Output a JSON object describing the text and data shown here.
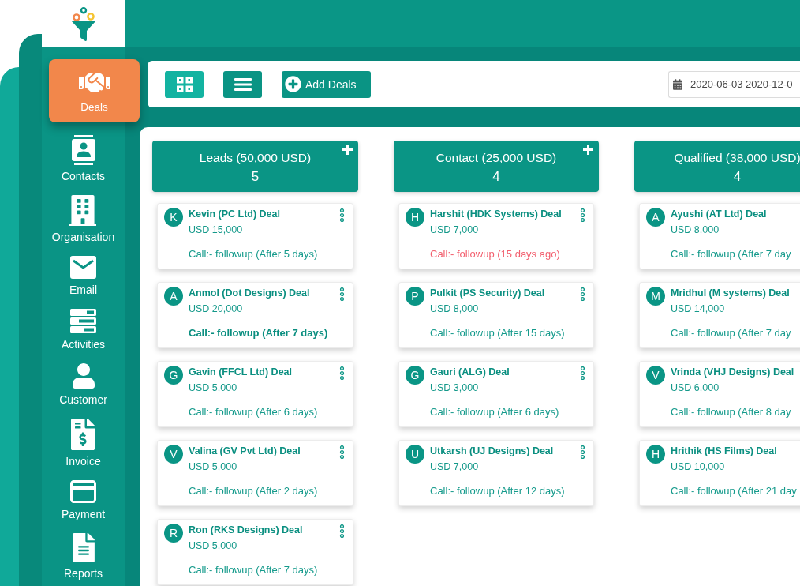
{
  "sidebar": {
    "items": [
      {
        "label": "Deals",
        "selected": true
      },
      {
        "label": "Contacts",
        "selected": false
      },
      {
        "label": "Organisation",
        "selected": false
      },
      {
        "label": "Email",
        "selected": false
      },
      {
        "label": "Activities",
        "selected": false
      },
      {
        "label": "Customer",
        "selected": false
      },
      {
        "label": "Invoice",
        "selected": false
      },
      {
        "label": "Payment",
        "selected": false
      },
      {
        "label": "Reports",
        "selected": false
      }
    ]
  },
  "toolbar": {
    "view_buttons": [
      {
        "kind": "grid",
        "selected": true
      },
      {
        "kind": "list",
        "selected": false
      }
    ],
    "add_button": {
      "label": "Add Deals"
    },
    "date_range": {
      "value": "2020-06-03 2020-12-0"
    }
  },
  "pipeline": {
    "columns": [
      {
        "title": "Leads (50,000 USD)",
        "count": "5",
        "cards": [
          {
            "initial": "K",
            "title": "Kevin (PC Ltd) Deal",
            "amount": "USD 15,000",
            "followup": "Call:- followup (After 5 days)",
            "overdue": false,
            "emphasized": false
          },
          {
            "initial": "A",
            "title": "Anmol (Dot Designs) Deal",
            "amount": "USD 20,000",
            "followup": "Call:- followup (After 7 days)",
            "overdue": false,
            "emphasized": true
          },
          {
            "initial": "G",
            "title": "Gavin (FFCL Ltd) Deal",
            "amount": "USD 5,000",
            "followup": "Call:- followup (After 6 days)",
            "overdue": false,
            "emphasized": false
          },
          {
            "initial": "V",
            "title": "Valina (GV Pvt Ltd) Deal",
            "amount": "USD 5,000",
            "followup": "Call:- followup (After 2 days)",
            "overdue": false,
            "emphasized": false
          },
          {
            "initial": "R",
            "title": "Ron (RKS Designs) Deal",
            "amount": "USD 5,000",
            "followup": "Call:- followup (After 7 days)",
            "overdue": false,
            "emphasized": false
          }
        ]
      },
      {
        "title": "Contact (25,000 USD)",
        "count": "4",
        "cards": [
          {
            "initial": "H",
            "title": "Harshit (HDK Systems) Deal",
            "amount": "USD 7,000",
            "followup": "Call:- followup (15 days ago)",
            "overdue": true,
            "emphasized": false
          },
          {
            "initial": "P",
            "title": "Pulkit (PS Security) Deal",
            "amount": "USD 8,000",
            "followup": "Call:- followup (After 15 days)",
            "overdue": false,
            "emphasized": false
          },
          {
            "initial": "G",
            "title": "Gauri (ALG) Deal",
            "amount": "USD 3,000",
            "followup": "Call:- followup (After 6 days)",
            "overdue": false,
            "emphasized": false
          },
          {
            "initial": "U",
            "title": "Utkarsh (UJ Designs) Deal",
            "amount": "USD 7,000",
            "followup": "Call:- followup (After 12 days)",
            "overdue": false,
            "emphasized": false
          }
        ]
      },
      {
        "title": "Qualified (38,000 USD)",
        "count": "4",
        "cards": [
          {
            "initial": "A",
            "title": "Ayushi (AT Ltd) Deal",
            "amount": "USD 8,000",
            "followup": "Call:- followup (After 7 day",
            "overdue": false,
            "emphasized": false
          },
          {
            "initial": "M",
            "title": "Mridhul (M systems) Deal",
            "amount": "USD 14,000",
            "followup": "Call:- followup (After 7 day",
            "overdue": false,
            "emphasized": false
          },
          {
            "initial": "V",
            "title": "Vrinda (VHJ Designs) Deal",
            "amount": "USD 6,000",
            "followup": "Call:- followup (After 8 day",
            "overdue": false,
            "emphasized": false
          },
          {
            "initial": "H",
            "title": "Hrithik (HS Films) Deal",
            "amount": "USD 10,000",
            "followup": "Call:- followup (After 21 day",
            "overdue": false,
            "emphasized": false
          }
        ]
      }
    ]
  }
}
